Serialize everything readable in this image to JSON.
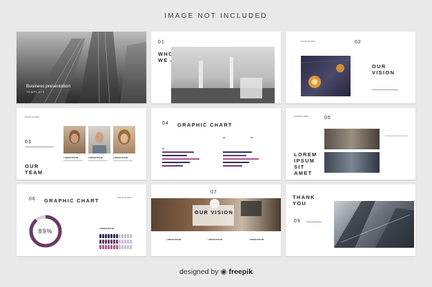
{
  "header": {
    "title": "IMAGE NOT INCLUDED"
  },
  "slide1": {
    "title": "Business presentation",
    "subtitle": "TEMPLATE"
  },
  "slide2": {
    "number": "01",
    "heading_line1": "WHO",
    "heading_line2": "WE ARE"
  },
  "slide3": {
    "number": "02",
    "heading_line1": "OUR",
    "heading_line2": "VISION",
    "small_text": "DOLOR SIT AMET"
  },
  "slide4": {
    "number": "03",
    "heading_line1": "OUR",
    "heading_line2": "TEAM",
    "small_text": "DOLOR SIT AMET",
    "captions": [
      "LOREM IPSUM",
      "LOREM IPSUM",
      "LOREM IPSUM"
    ]
  },
  "slide5": {
    "number": "04",
    "heading": "GRAPHIC CHART",
    "labels": [
      "01",
      "02",
      "03"
    ]
  },
  "slide6": {
    "number": "05",
    "heading_line1": "LOREM",
    "heading_line2": "IPSUM",
    "heading_line3": "SIT",
    "heading_line4": "AMET",
    "small_text": "DOLOR SIT AMET"
  },
  "slide7": {
    "number": "06",
    "heading": "GRAPHIC CHART",
    "percent": "89%",
    "percent_value": 0.89,
    "small_text": "DOLOR SIT AMET",
    "caption": "LOREM IPSUM"
  },
  "slide8": {
    "number": "07",
    "banner": "OUR VISION",
    "captions": [
      "LOREM IPSUM",
      "LOREM IPSUM",
      "LOREM IPSUM"
    ]
  },
  "slide9": {
    "heading_line1": "THANK",
    "heading_line2": "YOU",
    "number": "09"
  },
  "footer": {
    "prefix": "designed by",
    "brand": "freepik"
  },
  "colors": {
    "purple": "#6b3a67",
    "navy": "#2c2e5c",
    "rose": "#b0558a"
  }
}
